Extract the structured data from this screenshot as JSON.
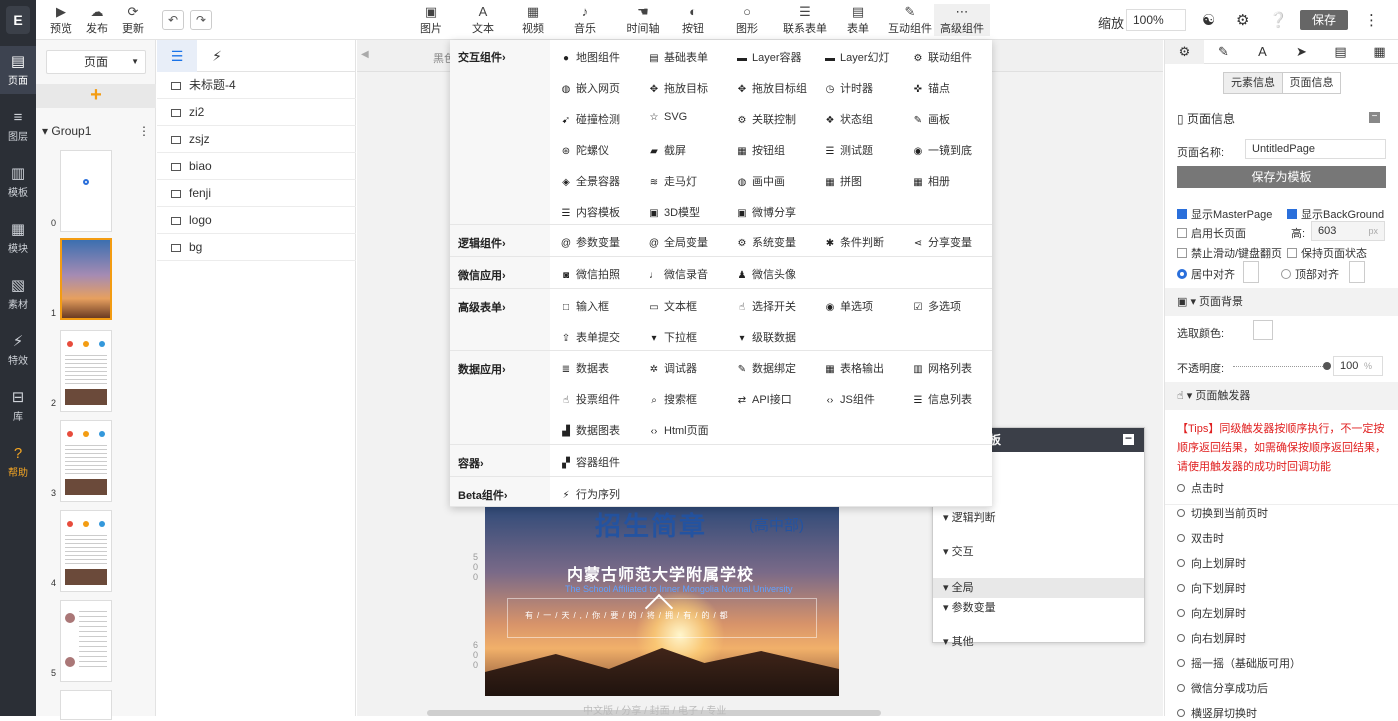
{
  "rail": {
    "logo": "E",
    "items": [
      {
        "label": "页面",
        "icon": "page-icon"
      },
      {
        "label": "图层",
        "icon": "layers-icon"
      },
      {
        "label": "模板",
        "icon": "template-icon"
      },
      {
        "label": "模块",
        "icon": "module-icon"
      },
      {
        "label": "素材",
        "icon": "image-icon"
      },
      {
        "label": "特效",
        "icon": "plug-icon"
      },
      {
        "label": "库",
        "icon": "library-icon"
      },
      {
        "label": "帮助",
        "icon": "help-icon"
      }
    ]
  },
  "toolbar": {
    "left": [
      {
        "label": "预览",
        "icon": "preview-icon"
      },
      {
        "label": "发布",
        "icon": "publish-icon"
      },
      {
        "label": "更新",
        "icon": "refresh-icon"
      }
    ],
    "undo": "↶",
    "redo": "↷",
    "tools": [
      {
        "label": "图片",
        "icon": "picture-icon"
      },
      {
        "label": "文本",
        "icon": "text-icon"
      },
      {
        "label": "视频",
        "icon": "video-icon"
      },
      {
        "label": "音乐",
        "icon": "music-icon"
      },
      {
        "label": "时间轴",
        "icon": "timeline-icon"
      },
      {
        "label": "按钮",
        "icon": "button-icon"
      },
      {
        "label": "图形",
        "icon": "shape-icon"
      },
      {
        "label": "联系表单",
        "icon": "contact-form-icon"
      },
      {
        "label": "表单",
        "icon": "form-icon"
      },
      {
        "label": "互动组件",
        "icon": "interactive-icon"
      },
      {
        "label": "高级组件",
        "icon": "more-icon"
      }
    ],
    "zoom_label": "缩放",
    "zoom_value": "100%",
    "save_label": "保存"
  },
  "page_panel": {
    "select_value": "页面",
    "add_icon": "+",
    "group_label": "Group1",
    "thumbnail_numbers": [
      "0",
      "1",
      "2",
      "3",
      "4",
      "5"
    ]
  },
  "layers": {
    "items": [
      "未标题-4",
      "zi2",
      "zsjz",
      "biao",
      "fenji",
      "logo",
      "bg"
    ]
  },
  "canvas": {
    "header_text": "黑色",
    "ruler_marks": [
      "5",
      "0",
      "0",
      "6",
      "0",
      "0"
    ],
    "hero": {
      "title": "招生简章",
      "subtitle": "(高中部)",
      "school": "内蒙古师范大学附属学校",
      "english": "The School Affiliated to Inner Mongolia Normal University",
      "poem": "有/一/天/,/你/要/的/将/拥/有/的/都"
    },
    "scroll_text": "中文版 / 分享 / 封面 / 电子 / 专业"
  },
  "trigger_panel": {
    "title": "板",
    "rows": [
      {
        "label": "▾ 逻辑判断",
        "grey": false
      },
      {
        "label": "▾ 交互",
        "grey": false
      },
      {
        "label": "▾ 全局",
        "grey": true
      },
      {
        "label": "▾ 参数变量",
        "grey": false
      },
      {
        "label": "▾ 其他",
        "grey": false
      }
    ]
  },
  "dropdown": {
    "sections": [
      {
        "category": "交互组件›",
        "items": [
          {
            "label": "地图组件",
            "icon": "map-pin-icon"
          },
          {
            "label": "基础表单",
            "icon": "form-doc-icon"
          },
          {
            "label": "Layer容器",
            "icon": "layer-box-icon"
          },
          {
            "label": "Layer幻灯",
            "icon": "slides-icon"
          },
          {
            "label": "联动组件",
            "icon": "gears-icon"
          },
          {
            "label": "嵌入网页",
            "icon": "globe-icon"
          },
          {
            "label": "拖放目标",
            "icon": "move-icon"
          },
          {
            "label": "拖放目标组",
            "icon": "move-group-icon"
          },
          {
            "label": "计时器",
            "icon": "clock-icon"
          },
          {
            "label": "锚点",
            "icon": "anchor-icon"
          },
          {
            "label": "碰撞检测",
            "icon": "collision-icon"
          },
          {
            "label": "SVG",
            "icon": "star-icon"
          },
          {
            "label": "关联控制",
            "icon": "link-gears-icon"
          },
          {
            "label": "状态组",
            "icon": "state-icon"
          },
          {
            "label": "画板",
            "icon": "brush-icon"
          },
          {
            "label": "陀螺仪",
            "icon": "gyro-icon"
          },
          {
            "label": "截屏",
            "icon": "screenshot-icon"
          },
          {
            "label": "按钮组",
            "icon": "grid-icon"
          },
          {
            "label": "测试题",
            "icon": "quiz-icon"
          },
          {
            "label": "一镜到底",
            "icon": "target-icon"
          },
          {
            "label": "全景容器",
            "icon": "panorama-icon"
          },
          {
            "label": "走马灯",
            "icon": "marquee-icon"
          },
          {
            "label": "画中画",
            "icon": "pip-icon"
          },
          {
            "label": "拼图",
            "icon": "puzzle-icon"
          },
          {
            "label": "相册",
            "icon": "album-icon"
          },
          {
            "label": "内容模板",
            "icon": "list-icon"
          },
          {
            "label": "3D模型",
            "icon": "cube-icon"
          },
          {
            "label": "微博分享",
            "icon": "weibo-icon"
          }
        ]
      },
      {
        "category": "逻辑组件›",
        "items": [
          {
            "label": "参数变量",
            "icon": "at-icon"
          },
          {
            "label": "全局变量",
            "icon": "at-icon"
          },
          {
            "label": "系统变量",
            "icon": "gear-icon"
          },
          {
            "label": "条件判断",
            "icon": "asterisk-icon"
          },
          {
            "label": "分享变量",
            "icon": "share-icon"
          }
        ]
      },
      {
        "category": "微信应用›",
        "items": [
          {
            "label": "微信拍照",
            "icon": "camera-icon"
          },
          {
            "label": "微信录音",
            "icon": "mic-icon"
          },
          {
            "label": "微信头像",
            "icon": "user-icon"
          }
        ]
      },
      {
        "category": "高级表单›",
        "items": [
          {
            "label": "输入框",
            "icon": "input-icon"
          },
          {
            "label": "文本框",
            "icon": "textarea-icon"
          },
          {
            "label": "选择开关",
            "icon": "hand-icon"
          },
          {
            "label": "单选项",
            "icon": "radio-icon"
          },
          {
            "label": "多选项",
            "icon": "checkbox-icon"
          },
          {
            "label": "表单提交",
            "icon": "upload-icon"
          },
          {
            "label": "下拉框",
            "icon": "dropdown-icon"
          },
          {
            "label": "级联数据",
            "icon": "cascade-icon"
          }
        ]
      },
      {
        "category": "数据应用›",
        "items": [
          {
            "label": "数据表",
            "icon": "database-icon"
          },
          {
            "label": "调试器",
            "icon": "bug-icon"
          },
          {
            "label": "数据绑定",
            "icon": "wrench-icon"
          },
          {
            "label": "表格输出",
            "icon": "table-icon"
          },
          {
            "label": "网格列表",
            "icon": "columns-icon"
          },
          {
            "label": "投票组件",
            "icon": "thumbs-up-icon"
          },
          {
            "label": "搜索框",
            "icon": "search-icon"
          },
          {
            "label": "API接口",
            "icon": "api-icon"
          },
          {
            "label": "JS组件",
            "icon": "code-icon"
          },
          {
            "label": "信息列表",
            "icon": "list-icon"
          },
          {
            "label": "数据图表",
            "icon": "chart-icon"
          },
          {
            "label": "Html页面",
            "icon": "html-icon"
          }
        ]
      },
      {
        "category": "容器›",
        "items": [
          {
            "label": "容器组件",
            "icon": "container-icon"
          }
        ]
      },
      {
        "category": "Beta组件›",
        "items": [
          {
            "label": "行为序列",
            "icon": "bolt-icon"
          }
        ]
      }
    ]
  },
  "right_panel": {
    "tabs": [
      "⚙",
      "✎",
      "A",
      "➤",
      "▤",
      "▦"
    ],
    "segments": [
      "元素信息",
      "页面信息"
    ],
    "page_info_title": "页面信息",
    "page_name_label": "页面名称:",
    "page_name_value": "UntitledPage",
    "save_template_label": "保存为模板",
    "show_master": "显示MasterPage",
    "show_bg": "显示BackGround",
    "long_page": "启用长页面",
    "height_label": "高:",
    "height_value": "603",
    "height_unit": "px",
    "disable_scroll": "禁止滑动/键盘翻页",
    "keep_state": "保持页面状态",
    "align_center": "居中对齐",
    "align_top": "顶部对齐",
    "bg_section": "页面背景",
    "pick_color_label": "选取颜色:",
    "opacity_label": "不透明度:",
    "opacity_value": "100",
    "opacity_unit": "%",
    "opacity_level": 1.0,
    "trigger_section": "页面触发器",
    "tips": "【Tips】同级触发器按顺序执行，不一定按顺序返回结果，如需确保按顺序返回结果，请使用触发器的成功时回调功能",
    "tips_color": "#e02020",
    "events": [
      "点击时",
      "切换到当前页时",
      "双击时",
      "向上划屏时",
      "向下划屏时",
      "向左划屏时",
      "向右划屏时",
      "摇一摇（基础版可用）",
      "微信分享成功后",
      "横竖屏切换时"
    ]
  },
  "colors": {
    "accent_orange": "#f39c12",
    "rail_bg": "#2b2f36",
    "checkbox_blue": "#2a6fdb"
  }
}
